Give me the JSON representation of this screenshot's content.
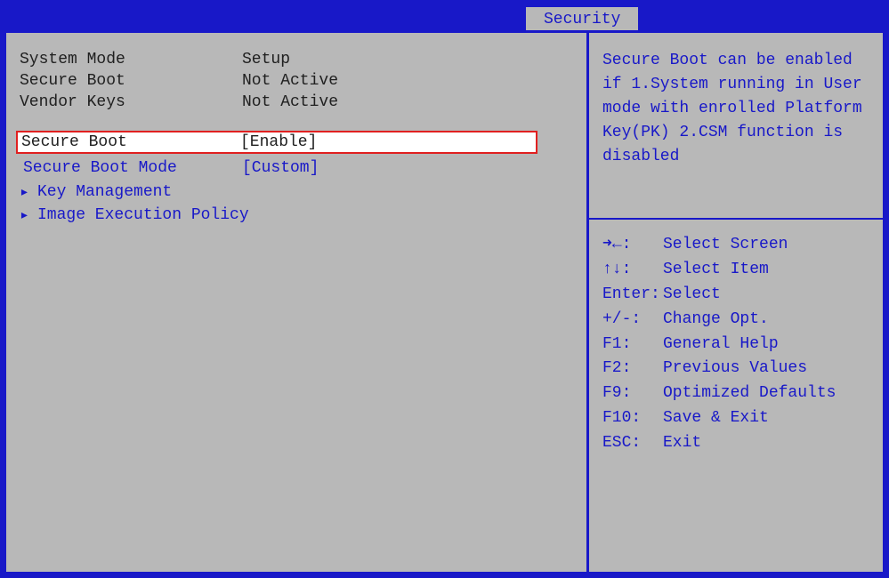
{
  "tab": {
    "label": "Security"
  },
  "info": {
    "system_mode": {
      "label": "System Mode",
      "value": "Setup"
    },
    "secure_boot": {
      "label": "Secure Boot",
      "value": "Not Active"
    },
    "vendor_keys": {
      "label": "Vendor Keys",
      "value": "Not Active"
    }
  },
  "menu": {
    "secure_boot": {
      "label": "Secure Boot",
      "value": "[Enable]"
    },
    "secure_boot_mode": {
      "label": "Secure Boot Mode",
      "value": "[Custom]"
    },
    "key_management": {
      "label": "Key Management"
    },
    "image_execution_policy": {
      "label": "Image Execution Policy"
    },
    "arrow": "▸"
  },
  "help": {
    "text": "Secure Boot can be enabled if 1.System running in User mode with enrolled Platform Key(PK) 2.CSM function is disabled"
  },
  "keys": [
    {
      "symbol": "➜←:",
      "desc": "Select Screen"
    },
    {
      "symbol": "↑↓:",
      "desc": "Select Item"
    },
    {
      "symbol": "Enter:",
      "desc": "Select"
    },
    {
      "symbol": "+/-:",
      "desc": "Change Opt."
    },
    {
      "symbol": "F1:",
      "desc": "General Help"
    },
    {
      "symbol": "F2:",
      "desc": "Previous Values"
    },
    {
      "symbol": "F9:",
      "desc": "Optimized Defaults"
    },
    {
      "symbol": "F10:",
      "desc": "Save & Exit"
    },
    {
      "symbol": "ESC:",
      "desc": "Exit"
    }
  ]
}
